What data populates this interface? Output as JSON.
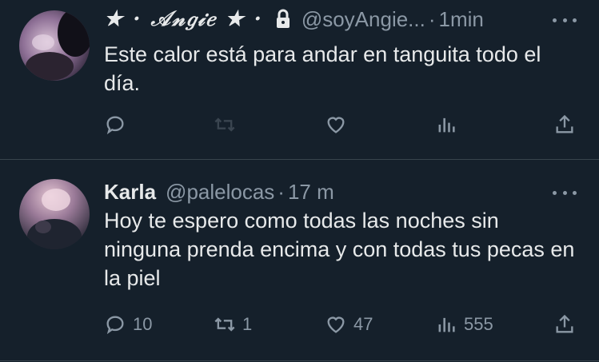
{
  "tweets": [
    {
      "display_name": "★ · 𝒜𝓃𝑔𝒾𝑒 ★ ·",
      "handle": "@soyAngie...",
      "time": "1min",
      "text": "Este calor está para andar en tanguita todo el día.",
      "replies": "",
      "retweets": "",
      "likes": "",
      "views": ""
    },
    {
      "display_name": "Karla",
      "handle": "@palelocas",
      "time": "17 m",
      "text": "Hoy te espero como todas las noches sin ninguna prenda encima y con todas tus pecas en la piel",
      "replies": "10",
      "retweets": "1",
      "likes": "47",
      "views": "555"
    }
  ],
  "separator": "·",
  "colors": {
    "background": "#15202b",
    "text": "#e7e9ea",
    "secondary": "#8b98a5",
    "divider": "#38444d"
  },
  "icons": [
    "reply-icon",
    "retweet-icon",
    "like-icon",
    "views-icon",
    "share-icon",
    "lock-icon",
    "more-icon"
  ]
}
